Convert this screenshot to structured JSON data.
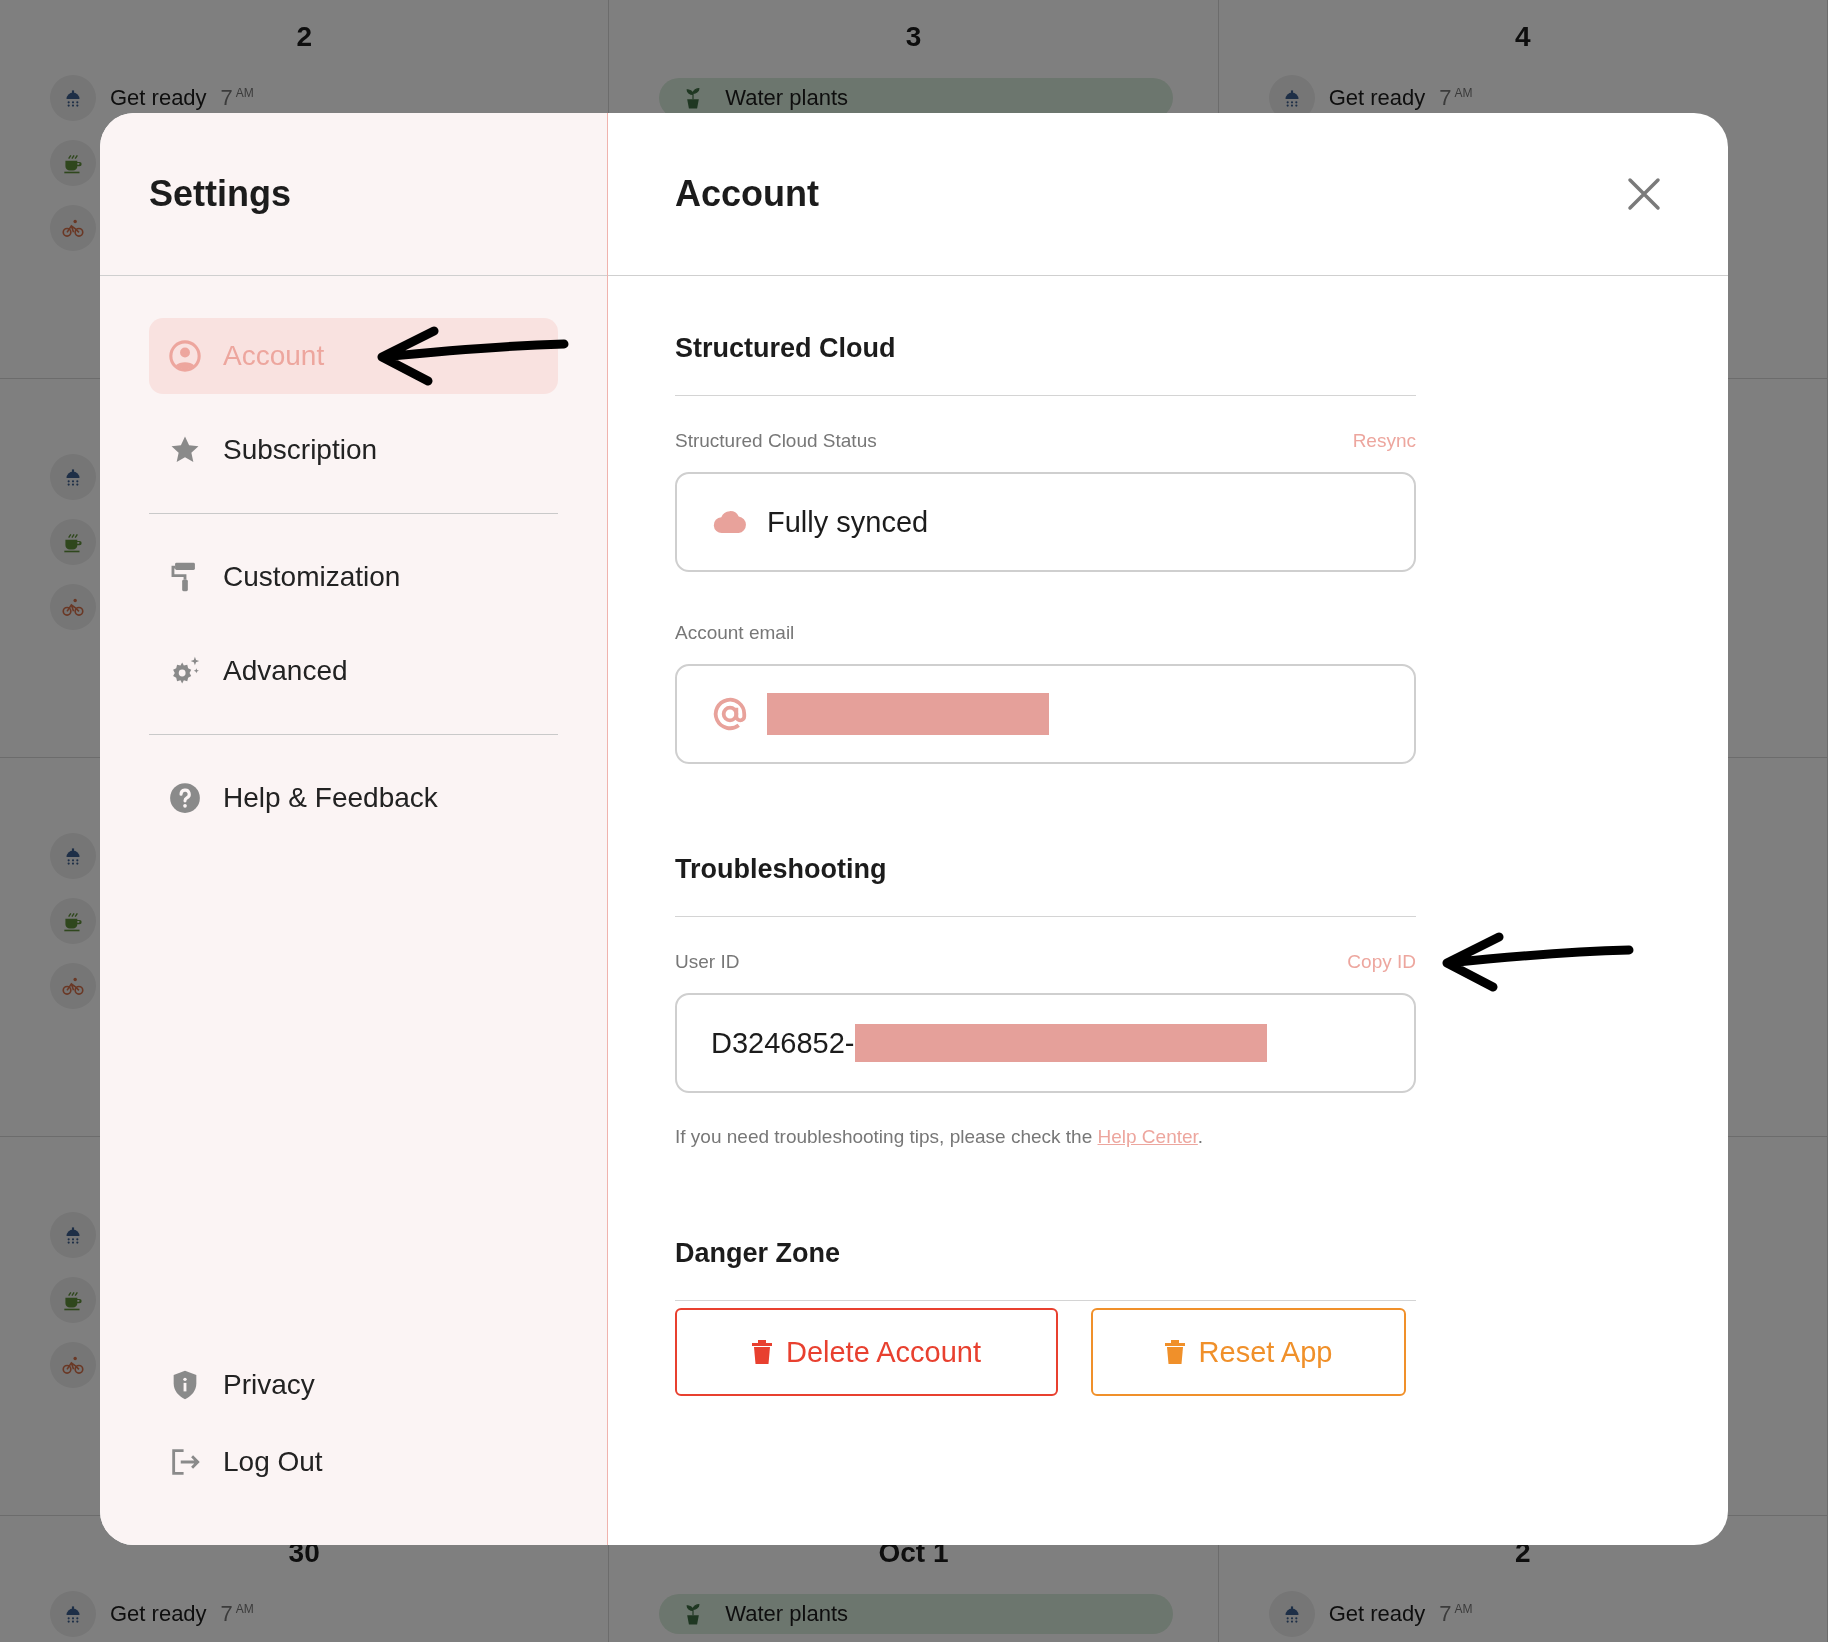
{
  "calendar": {
    "cells": [
      {
        "day": "2",
        "events": [
          {
            "kind": "shower",
            "title": "Get ready",
            "time": "7",
            "meridiem": "AM"
          },
          {
            "kind": "coffee"
          },
          {
            "kind": "bike"
          }
        ]
      },
      {
        "day": "3",
        "events": [
          {
            "kind": "plant",
            "title": "Water plants"
          }
        ]
      },
      {
        "day": "4",
        "events": [
          {
            "kind": "shower",
            "title": "Get ready",
            "time": "7",
            "meridiem": "AM"
          }
        ]
      },
      {
        "events": [
          {
            "kind": "shower"
          },
          {
            "kind": "coffee"
          },
          {
            "kind": "bike"
          }
        ]
      },
      {},
      {},
      {
        "events": [
          {
            "kind": "shower"
          },
          {
            "kind": "coffee"
          },
          {
            "kind": "bike"
          }
        ]
      },
      {},
      {},
      {
        "events": [
          {
            "kind": "shower"
          },
          {
            "kind": "coffee"
          },
          {
            "kind": "bike"
          }
        ]
      },
      {},
      {},
      {
        "day": "30",
        "events": [
          {
            "kind": "shower",
            "title": "Get ready",
            "time": "7",
            "meridiem": "AM"
          }
        ]
      },
      {
        "day": "Oct 1",
        "events": [
          {
            "kind": "plant",
            "title": "Water plants"
          }
        ]
      },
      {
        "day": "2",
        "events": [
          {
            "kind": "shower",
            "title": "Get ready",
            "time": "7",
            "meridiem": "AM"
          }
        ]
      }
    ]
  },
  "sidebar": {
    "title": "Settings",
    "nav_groups": [
      {
        "items": [
          {
            "label": "Account",
            "kind": "user",
            "selected": true,
            "arrow": true
          },
          {
            "label": "Subscription",
            "kind": "star",
            "selected": false,
            "arrow": false
          }
        ]
      },
      {
        "items": [
          {
            "label": "Customization",
            "kind": "roller",
            "selected": false,
            "arrow": false
          },
          {
            "label": "Advanced",
            "kind": "gear",
            "selected": false,
            "arrow": false
          }
        ]
      },
      {
        "items": [
          {
            "label": "Help & Feedback",
            "kind": "help",
            "selected": false,
            "arrow": false
          }
        ]
      }
    ],
    "footer_items": [
      {
        "label": "Privacy",
        "kind": "shield",
        "selected": false,
        "arrow": false
      },
      {
        "label": "Log Out",
        "kind": "logout",
        "selected": false,
        "arrow": false
      }
    ]
  },
  "panel": {
    "title": "Account",
    "sections": [
      {
        "title": "Structured Cloud",
        "fields": [
          {
            "label": "Structured Cloud Status",
            "action": "Resync",
            "kind": "cloud",
            "value": "Fully synced",
            "redacted": false,
            "arrow": false
          },
          {
            "label": "Account email",
            "kind": "at",
            "redacted": true,
            "arrow": false
          }
        ]
      },
      {
        "title": "Troubleshooting",
        "fields": [
          {
            "label": "User ID",
            "action": "Copy ID",
            "kind": "text",
            "value": "D3246852-",
            "redacted": true,
            "arrow": true
          }
        ],
        "note": {
          "text": "If you need troubleshooting tips, please check the ",
          "link": "Help Center",
          "end": "."
        }
      },
      {
        "title": "Danger Zone",
        "buttons": [
          {
            "label": "Delete Account",
            "color": "#e8402f"
          },
          {
            "label": "Reset App",
            "color": "#f0902a"
          }
        ]
      }
    ]
  }
}
